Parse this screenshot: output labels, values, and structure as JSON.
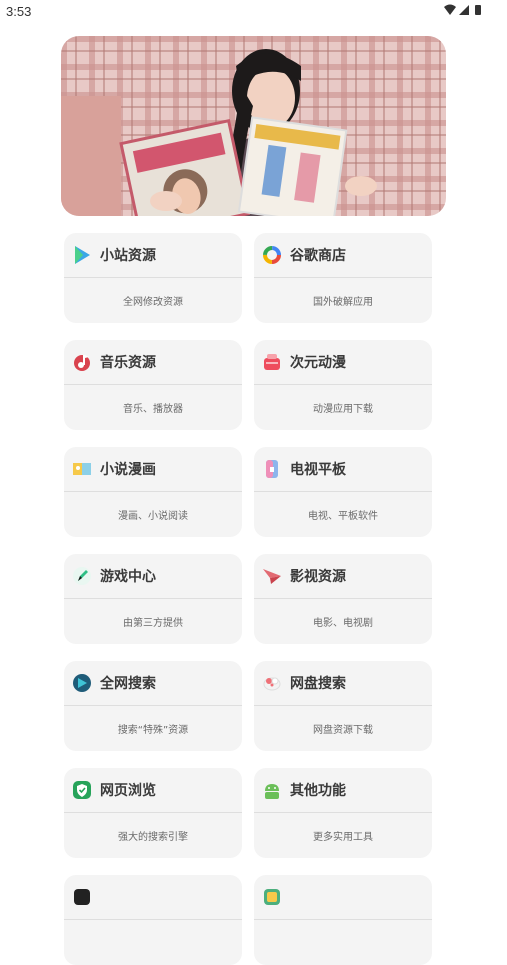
{
  "status_bar": {
    "time": "3:53"
  },
  "items": [
    {
      "title": "小站资源",
      "subtitle": "全网修改资源",
      "icon": "play-triangle-icon"
    },
    {
      "title": "谷歌商店",
      "subtitle": "国外破解应用",
      "icon": "google-ring-icon"
    },
    {
      "title": "音乐资源",
      "subtitle": "音乐、播放器",
      "icon": "music-note-icon"
    },
    {
      "title": "次元动漫",
      "subtitle": "动漫应用下载",
      "icon": "anime-box-icon"
    },
    {
      "title": "小说漫画",
      "subtitle": "漫画、小说阅读",
      "icon": "book-icon"
    },
    {
      "title": "电视平板",
      "subtitle": "电视、平板软件",
      "icon": "tablet-icon"
    },
    {
      "title": "游戏中心",
      "subtitle": "由第三方提供",
      "icon": "pencil-icon"
    },
    {
      "title": "影视资源",
      "subtitle": "电影、电视剧",
      "icon": "paper-plane-icon"
    },
    {
      "title": "全网搜索",
      "subtitle": "搜索“特殊”资源",
      "icon": "search-play-icon"
    },
    {
      "title": "网盘搜索",
      "subtitle": "网盘资源下载",
      "icon": "cloud-disk-icon"
    },
    {
      "title": "网页浏览",
      "subtitle": "强大的搜索引擎",
      "icon": "browser-shield-icon"
    },
    {
      "title": "其他功能",
      "subtitle": "更多实用工具",
      "icon": "android-icon"
    }
  ],
  "colors": {
    "card_bg": "#f4f4f4",
    "title": "#3a3a3a",
    "subtitle": "#6a6a6a"
  }
}
